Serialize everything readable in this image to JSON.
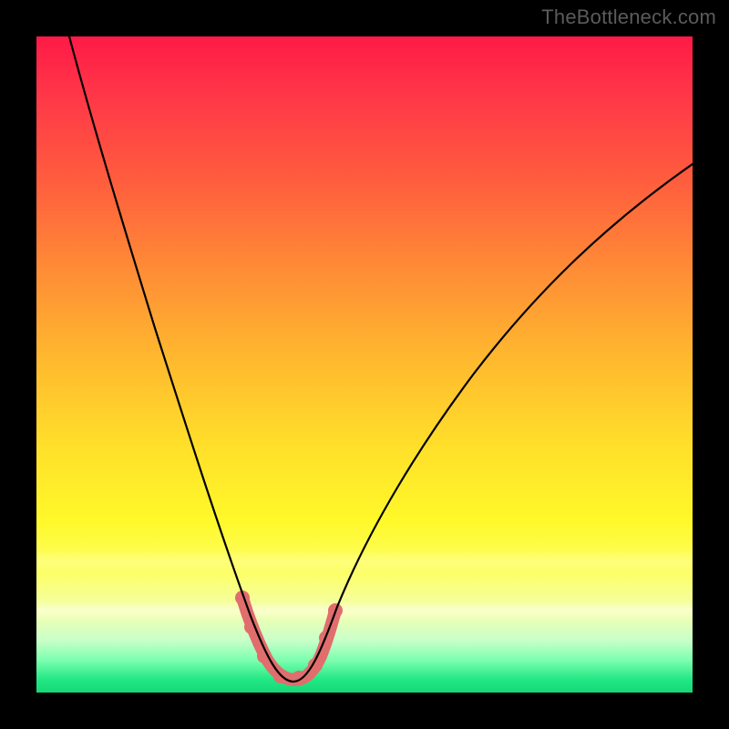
{
  "attribution": "TheBottleneck.com",
  "colors": {
    "background": "#000000",
    "curve": "#000000",
    "marker": "#e16d6d"
  },
  "chart_data": {
    "type": "line",
    "title": "",
    "xlabel": "",
    "ylabel": "",
    "xlim": [
      0,
      100
    ],
    "ylim": [
      0,
      100
    ],
    "grid": false,
    "legend": false,
    "series": [
      {
        "name": "bottleneck-curve",
        "x": [
          5,
          8,
          12,
          16,
          20,
          24,
          28,
          31,
          33,
          35,
          37,
          39,
          41,
          45,
          50,
          55,
          60,
          65,
          70,
          75,
          80,
          85,
          90,
          95,
          100
        ],
        "y": [
          100,
          88,
          75,
          62,
          50,
          38,
          25,
          14,
          8,
          4,
          2,
          2,
          4,
          10,
          18,
          26,
          33,
          40,
          47,
          54,
          60,
          66,
          72,
          77,
          82
        ]
      }
    ],
    "annotations": [
      {
        "name": "minimum-marker",
        "x_range": [
          31,
          41
        ],
        "y_range": [
          1,
          14
        ]
      }
    ],
    "background_gradient": {
      "direction": "vertical",
      "stops": [
        {
          "pos": 0.0,
          "color": "#ff1a47"
        },
        {
          "pos": 0.35,
          "color": "#ff8a36"
        },
        {
          "pos": 0.62,
          "color": "#ffde2a"
        },
        {
          "pos": 0.88,
          "color": "#f1ffb0"
        },
        {
          "pos": 1.0,
          "color": "#15d877"
        }
      ]
    }
  }
}
